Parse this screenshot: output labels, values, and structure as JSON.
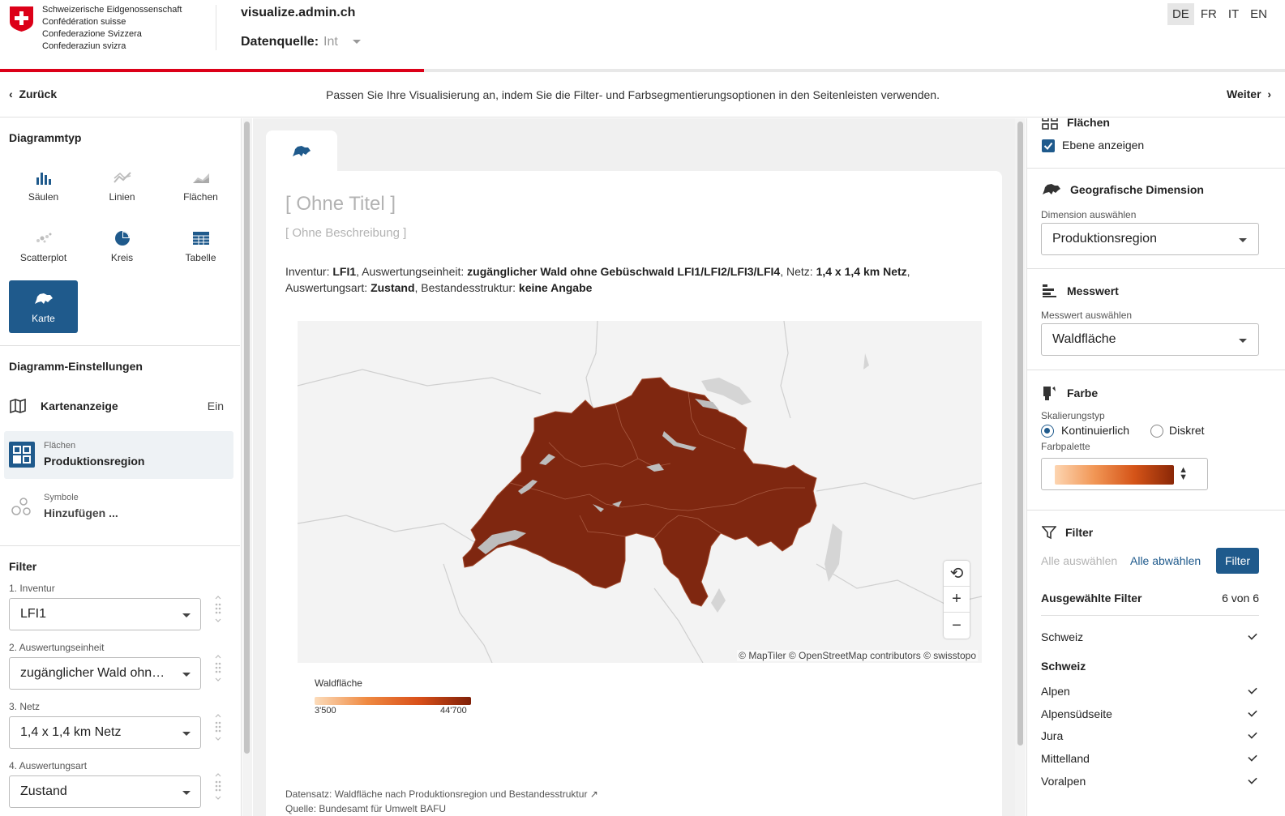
{
  "header": {
    "confederation": [
      "Schweizerische Eidgenossenschaft",
      "Confédération suisse",
      "Confederazione Svizzera",
      "Confederaziun svizra"
    ],
    "site_title": "visualize.admin.ch",
    "datasource_label": "Datenquelle:",
    "datasource_value": "Int",
    "languages": [
      "DE",
      "FR",
      "IT",
      "EN"
    ],
    "active_language": "DE",
    "progress_fraction": 0.33,
    "accent_color": "#dc0018"
  },
  "stepnav": {
    "back_label": "Zurück",
    "message": "Passen Sie Ihre Visualisierung an, indem Sie die Filter- und Farbsegmentierungsoptionen in den Seitenleisten verwenden.",
    "next_label": "Weiter"
  },
  "left": {
    "chart_types_title": "Diagrammtyp",
    "chart_types": [
      {
        "label": "Säulen",
        "icon": "column-chart-icon"
      },
      {
        "label": "Linien",
        "icon": "line-chart-icon"
      },
      {
        "label": "Flächen",
        "icon": "area-chart-icon"
      },
      {
        "label": "Scatterplot",
        "icon": "scatterplot-icon"
      },
      {
        "label": "Kreis",
        "icon": "pie-chart-icon"
      },
      {
        "label": "Tabelle",
        "icon": "table-icon"
      },
      {
        "label": "Karte",
        "icon": "map-switzerland-icon"
      }
    ],
    "active_chart_type": "Karte",
    "settings_title": "Diagramm-Einstellungen",
    "kartenanzeige": {
      "label": "Kartenanzeige",
      "state": "Ein"
    },
    "flaechen": {
      "sub": "Flächen",
      "main": "Produktionsregion"
    },
    "symbole": {
      "sub": "Symbole",
      "main": "Hinzufügen ..."
    },
    "filter_title": "Filter",
    "filters": [
      {
        "label": "1. Inventur",
        "value": "LFI1"
      },
      {
        "label": "2. Auswertungseinheit",
        "value": "zugänglicher Wald ohne Gebüschwald LFI1/LFI2/LFI3/LFI4"
      },
      {
        "label": "3. Netz",
        "value": "1,4 x 1,4 km Netz"
      },
      {
        "label": "4. Auswertungsart",
        "value": "Zustand"
      }
    ]
  },
  "center": {
    "tab_icon": "map-switzerland-icon",
    "title": "[ Ohne Titel ]",
    "description": "[ Ohne Beschreibung ]",
    "meta": [
      {
        "k": "Inventur: ",
        "v": "LFI1"
      },
      {
        "k": ", Auswertungseinheit: ",
        "v": "zugänglicher Wald ohne Gebüschwald LFI1/LFI2/LFI3/LFI4"
      },
      {
        "k": ", Netz: ",
        "v": "1,4 x 1,4 km Netz"
      },
      {
        "k": ", Auswertungsart: ",
        "v": "Zustand"
      },
      {
        "k": ", Bestandesstruktur: ",
        "v": "keine Angabe"
      }
    ],
    "attribution": "© MapTiler © OpenStreetMap contributors © swisstopo",
    "legend": {
      "title": "Waldfläche",
      "min": "3'500",
      "max": "44'700"
    },
    "fill_color": "#7f2710",
    "source_line": "Datensatz: Waldfläche nach Produktionsregion und Bestandesstruktur",
    "source_line2": "Quelle: Bundesamt für Umwelt BAFU"
  },
  "right": {
    "flaechen_title": "Flächen",
    "show_layer": "Ebene anzeigen",
    "geo_title": "Geografische Dimension",
    "geo_small": "Dimension auswählen",
    "geo_value": "Produktionsregion",
    "measure_title": "Messwert",
    "measure_small": "Messwert auswählen",
    "measure_value": "Waldfläche",
    "color_title": "Farbe",
    "scale_type_label": "Skalierungstyp",
    "scale_continuous": "Kontinuierlich",
    "scale_discrete": "Diskret",
    "palette_label": "Farbpalette",
    "filter_title": "Filter",
    "select_all": "Alle auswählen",
    "deselect_all": "Alle abwählen",
    "filter_button": "Filter",
    "selected_filters": "Ausgewählte Filter",
    "selected_count": "6 von 6",
    "items": [
      {
        "label": "Schweiz",
        "checked": true
      },
      {
        "label": "Schweiz",
        "checked": false,
        "group": true
      },
      {
        "label": "Alpen",
        "checked": true
      },
      {
        "label": "Alpensüdseite",
        "checked": true
      },
      {
        "label": "Jura",
        "checked": true
      },
      {
        "label": "Mittelland",
        "checked": true
      },
      {
        "label": "Voralpen",
        "checked": true
      }
    ]
  }
}
